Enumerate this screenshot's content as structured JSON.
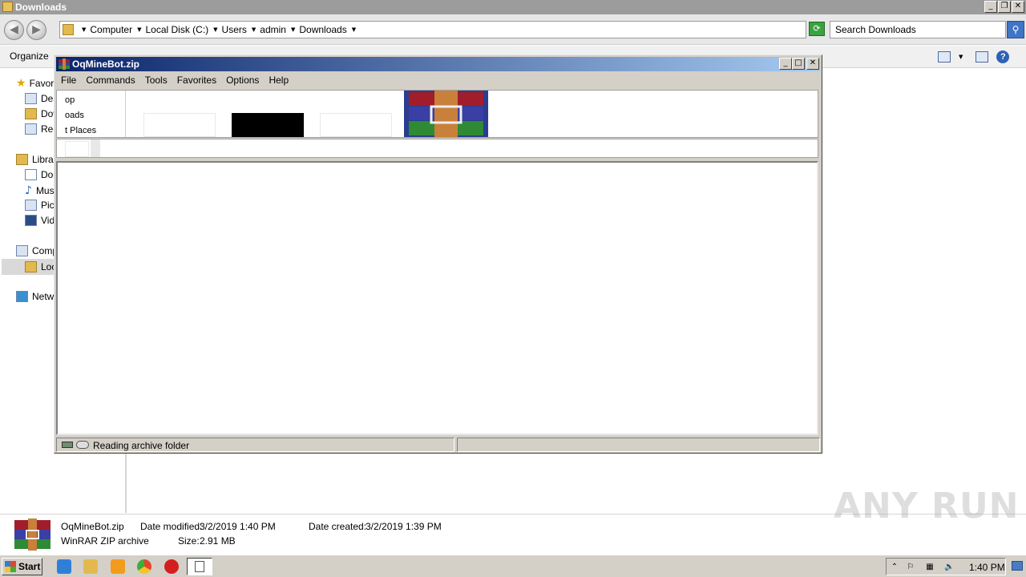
{
  "explorer": {
    "title": "Downloads",
    "breadcrumbs": [
      "Computer",
      "Local Disk (C:)",
      "Users",
      "admin",
      "Downloads"
    ],
    "search_placeholder": "Search Downloads",
    "organize_label": "Organize",
    "nav": {
      "favorites": "Favorites",
      "desktop": "Desktop",
      "downloads": "Downloads",
      "recent_places": "Recent Places",
      "libraries": "Libraries",
      "documents": "Documents",
      "music": "Music",
      "pictures": "Pictures",
      "videos": "Videos",
      "computer": "Computer",
      "local_disk": "Local Disk (C:)",
      "network": "Network"
    },
    "details": {
      "file_name": "OqMineBot.zip",
      "file_type": "WinRAR ZIP archive",
      "date_modified_label": "Date modified:",
      "date_modified": "3/2/2019 1:40 PM",
      "date_created_label": "Date created:",
      "date_created": "3/2/2019 1:39 PM",
      "size_label": "Size:",
      "size": "2.91 MB"
    }
  },
  "winrar": {
    "title": "OqMineBot.zip",
    "menu": [
      "File",
      "Commands",
      "Tools",
      "Favorites",
      "Options",
      "Help"
    ],
    "places_visible": [
      "op",
      "oads",
      "t Places"
    ],
    "status_text": "Reading archive folder"
  },
  "taskbar": {
    "start_label": "Start",
    "clock": "1:40 PM"
  },
  "watermark": "ANY RUN",
  "colors": {
    "winrar_title_start": "#0a246a",
    "winrar_title_end": "#a6caf0",
    "explorer_title": "#9c9c9c"
  }
}
